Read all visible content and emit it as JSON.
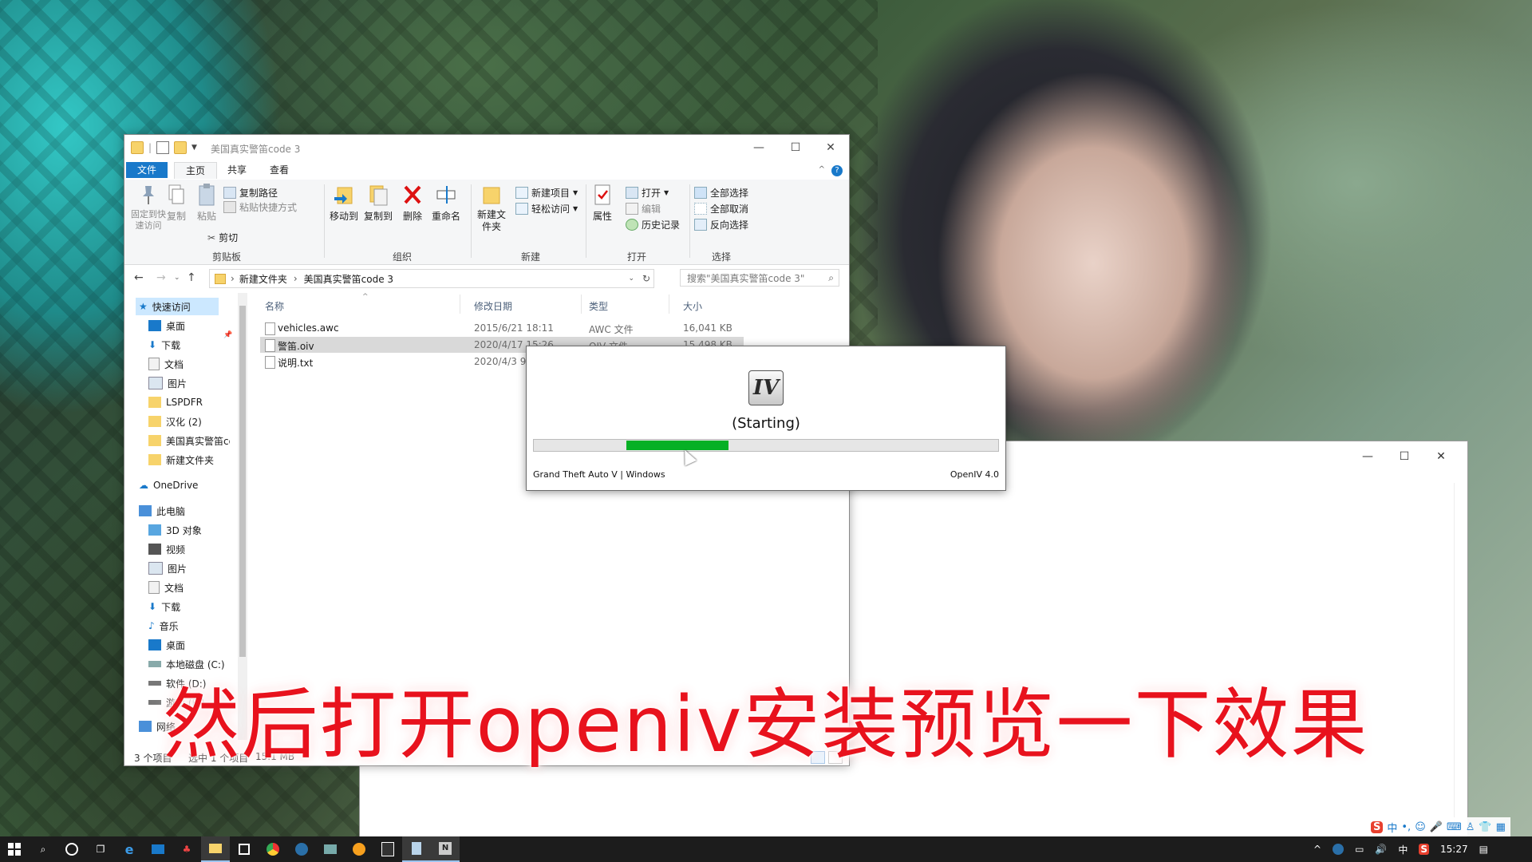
{
  "explorer": {
    "title": "美国真实警笛code 3",
    "tabs": {
      "file": "文件",
      "home": "主页",
      "share": "共享",
      "view": "查看"
    },
    "ribbon": {
      "pin_quick_access": "固定到快速访问",
      "copy": "复制",
      "paste": "粘贴",
      "copy_path": "复制路径",
      "paste_shortcut": "粘贴快捷方式",
      "cut": "剪切",
      "clipboard_group": "剪贴板",
      "move_to": "移动到",
      "copy_to": "复制到",
      "delete": "删除",
      "rename": "重命名",
      "organize_group": "组织",
      "new_folder": "新建文件夹",
      "new_item": "新建项目",
      "easy_access": "轻松访问",
      "new_group": "新建",
      "properties": "属性",
      "open": "打开",
      "edit": "编辑",
      "history": "历史记录",
      "open_group": "打开",
      "select_all": "全部选择",
      "select_none": "全部取消",
      "invert_selection": "反向选择",
      "select_group": "选择"
    },
    "address": {
      "crumb1": "新建文件夹",
      "crumb2": "美国真实警笛code 3",
      "search_placeholder": "搜索\"美国真实警笛code 3\""
    },
    "nav": {
      "quick_access": "快速访问",
      "desktop": "桌面",
      "downloads": "下载",
      "documents": "文档",
      "pictures": "图片",
      "lspdfr": "LSPDFR",
      "hanhua": "汉化 (2)",
      "siren_folder": "美国真实警笛co",
      "new_folder": "新建文件夹",
      "onedrive": "OneDrive",
      "this_pc": "此电脑",
      "objects3d": "3D 对象",
      "videos": "视频",
      "pictures2": "图片",
      "documents2": "文档",
      "downloads2": "下载",
      "music": "音乐",
      "desktop2": "桌面",
      "drive_c": "本地磁盘 (C:)",
      "drive_d": "软件 (D:)",
      "drive_e": "游戏 (E:)",
      "network": "网络"
    },
    "columns": {
      "name": "名称",
      "modified": "修改日期",
      "type": "类型",
      "size": "大小"
    },
    "files": [
      {
        "name": "vehicles.awc",
        "modified": "2015/6/21 18:11",
        "type": "AWC 文件",
        "size": "16,041 KB"
      },
      {
        "name": "警笛.oiv",
        "modified": "2020/4/17 15:26",
        "type": "OIV 文件",
        "size": "15,498 KB"
      },
      {
        "name": "说明.txt",
        "modified": "2020/4/3 9:",
        "type": "",
        "size": ""
      }
    ],
    "status": {
      "count": "3 个项目",
      "selected": "选中 1 个项目",
      "size": "15.1 MB"
    }
  },
  "openiv": {
    "logo": "IV",
    "status": "(Starting)",
    "progress_start": 0.2,
    "progress_end": 0.42,
    "game": "Grand Theft Auto V | Windows",
    "version": "OpenIV 4.0"
  },
  "subtitle": "然后打开openiv安装预览一下效果",
  "ime": {
    "mode": "中"
  },
  "taskbar": {
    "clock": "15:27",
    "ime_label": "中"
  },
  "colors": {
    "accent": "#1979ca",
    "progress": "#06b025",
    "subtitle": "#e8121d"
  }
}
